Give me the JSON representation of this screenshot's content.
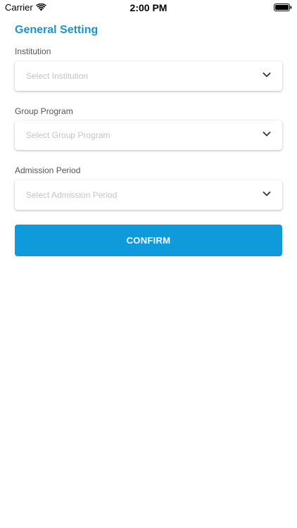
{
  "status_bar": {
    "carrier": "Carrier",
    "time": "2:00 PM"
  },
  "page": {
    "title": "General Setting"
  },
  "fields": [
    {
      "label": "Institution",
      "placeholder": "Select Institution"
    },
    {
      "label": "Group Program",
      "placeholder": "Select Group Program"
    },
    {
      "label": "Admission Period",
      "placeholder": "Select Admission Period"
    }
  ],
  "actions": {
    "confirm_label": "CONFIRM"
  },
  "colors": {
    "title": "#1a93cf",
    "button": "#0f9bdb",
    "placeholder": "#c4c4c4"
  },
  "icons": [
    "wifi-icon",
    "battery-icon",
    "chevron-down-icon"
  ]
}
